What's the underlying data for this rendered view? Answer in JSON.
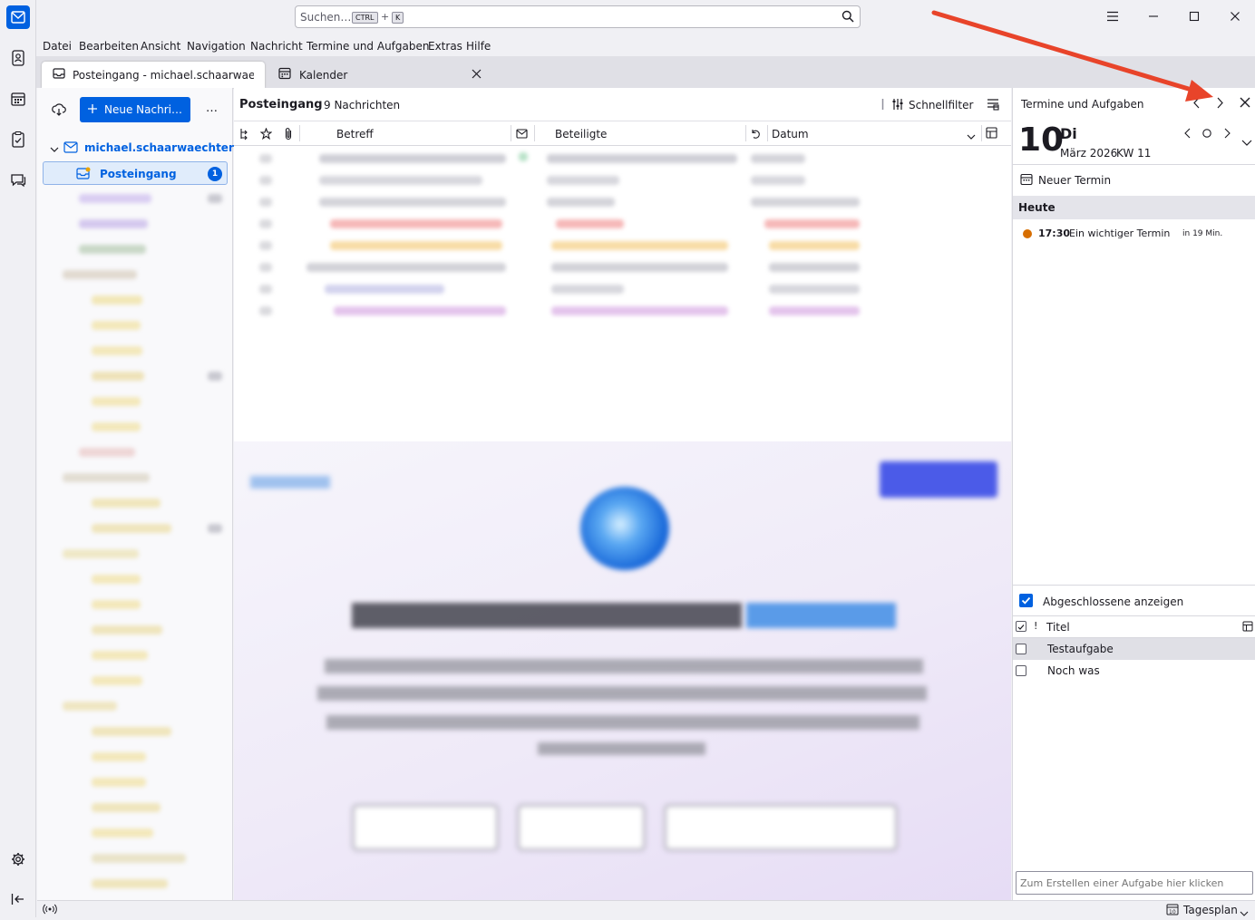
{
  "search": {
    "placeholder": "Suchen…",
    "kbd_ctrl": "CTRL",
    "kbd_plus": "+",
    "kbd_k": "K"
  },
  "menu": [
    "Datei",
    "Bearbeiten",
    "Ansicht",
    "Navigation",
    "Nachricht",
    "Termine und Aufgaben",
    "Extras",
    "Hilfe"
  ],
  "tabs": [
    {
      "label": "Posteingang - michael.schaarwaechter@"
    },
    {
      "label": "Kalender"
    }
  ],
  "folder_pane": {
    "new_message": "Neue Nachri…",
    "more": "…",
    "account": "michael.schaarwaechter…",
    "inbox": "Posteingang",
    "inbox_badge": "1"
  },
  "message_list": {
    "folder": "Posteingang",
    "count": "9 Nachrichten",
    "quick_filter": "Schnellfilter",
    "columns": {
      "subject": "Betreff",
      "correspondents": "Beteiligte",
      "date": "Datum"
    }
  },
  "today_pane": {
    "title": "Termine und Aufgaben",
    "day_number": "10",
    "weekday": "Di",
    "month_year": "März 2026",
    "week": "KW 11",
    "new_event": "Neuer Termin",
    "section_today": "Heute",
    "event_time": "17:30",
    "event_title": "Ein wichtiger Termin",
    "event_rel": "in 19 Min.",
    "show_completed": "Abgeschlossene anzeigen",
    "task_col_priority": "!",
    "task_col_title": "Titel",
    "tasks": [
      {
        "title": "Testaufgabe"
      },
      {
        "title": "Noch was"
      }
    ],
    "new_task_placeholder": "Zum Erstellen einer Aufgabe hier klicken"
  },
  "statusbar": {
    "day_view": "Tagesplan"
  },
  "colors": {
    "accent": "#0061e0",
    "event_dot": "#d76e00",
    "arrow": "#e8442a"
  }
}
